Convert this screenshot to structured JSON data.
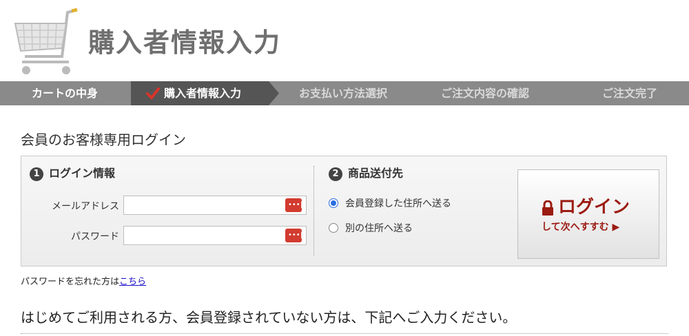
{
  "header": {
    "title": "購入者情報入力",
    "cart_icon": "shopping-cart-icon"
  },
  "steps": [
    {
      "label": "カートの中身",
      "state": "done"
    },
    {
      "label": "購入者情報入力",
      "state": "current"
    },
    {
      "label": "お支払い方法選択",
      "state": "todo"
    },
    {
      "label": "ご注文内容の確認",
      "state": "todo"
    },
    {
      "label": "ご注文完了",
      "state": "todo"
    }
  ],
  "colors": {
    "step_bar": "#8a8a8a",
    "step_current": "#555555",
    "accent_red": "#9b1b12",
    "radio_blue": "#2c6fe0"
  },
  "login": {
    "section_title": "会員のお客様専用ログイン",
    "col1_num": "1",
    "col1_title": "ログイン情報",
    "email_label": "メールアドレス",
    "email_value": "",
    "password_label": "パスワード",
    "password_value": "",
    "col2_num": "2",
    "col2_title": "商品送付先",
    "radio1_label": "会員登録した住所へ送る",
    "radio2_label": "別の住所へ送る",
    "button_main": "ログイン",
    "button_sub": "して次へすすむ ▶"
  },
  "forgot": {
    "text": "パスワードを忘れた方は",
    "link": "こちら"
  },
  "bottom_text": "はじめてご利用される方、会員登録されていない方は、下記へご入力ください。"
}
